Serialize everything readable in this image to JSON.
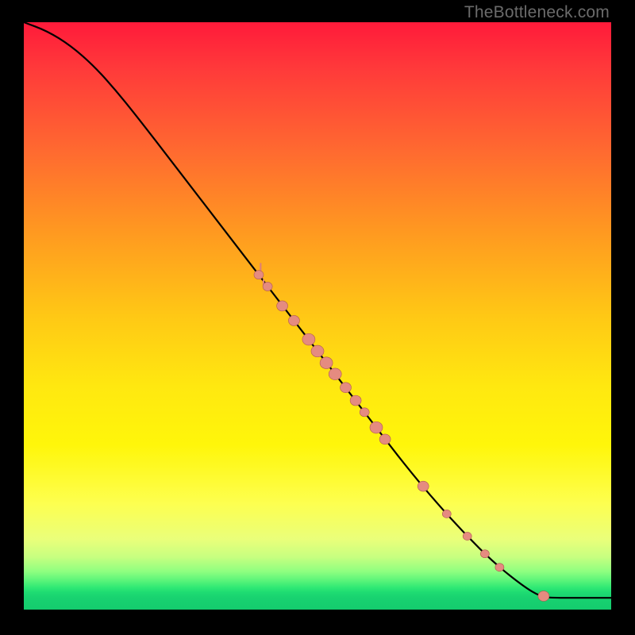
{
  "watermark": "TheBottleneck.com",
  "chart_data": {
    "type": "line",
    "title": "",
    "xlabel": "",
    "ylabel": "",
    "xlim": [
      0,
      100
    ],
    "ylim": [
      0,
      100
    ],
    "curve": [
      {
        "x": 0,
        "y": 100
      },
      {
        "x": 4,
        "y": 98.5
      },
      {
        "x": 8,
        "y": 96
      },
      {
        "x": 12,
        "y": 92.5
      },
      {
        "x": 16,
        "y": 88
      },
      {
        "x": 20,
        "y": 83
      },
      {
        "x": 25,
        "y": 76.5
      },
      {
        "x": 30,
        "y": 70
      },
      {
        "x": 35,
        "y": 63.5
      },
      {
        "x": 40,
        "y": 57
      },
      {
        "x": 45,
        "y": 50.5
      },
      {
        "x": 50,
        "y": 44
      },
      {
        "x": 55,
        "y": 37.5
      },
      {
        "x": 60,
        "y": 31
      },
      {
        "x": 65,
        "y": 24.5
      },
      {
        "x": 70,
        "y": 18.5
      },
      {
        "x": 75,
        "y": 13
      },
      {
        "x": 80,
        "y": 8
      },
      {
        "x": 85,
        "y": 4
      },
      {
        "x": 88,
        "y": 2.2
      },
      {
        "x": 90,
        "y": 2
      },
      {
        "x": 95,
        "y": 2
      },
      {
        "x": 100,
        "y": 2
      }
    ],
    "clusters": [
      {
        "x": 40,
        "y": 57,
        "r": 6
      },
      {
        "x": 41.5,
        "y": 55,
        "r": 6
      },
      {
        "x": 44,
        "y": 51.7,
        "r": 7
      },
      {
        "x": 46,
        "y": 49.2,
        "r": 7
      },
      {
        "x": 48.5,
        "y": 46,
        "r": 8
      },
      {
        "x": 50,
        "y": 44,
        "r": 8
      },
      {
        "x": 51.5,
        "y": 42,
        "r": 8
      },
      {
        "x": 53,
        "y": 40.1,
        "r": 8
      },
      {
        "x": 54.8,
        "y": 37.8,
        "r": 7
      },
      {
        "x": 56.5,
        "y": 35.6,
        "r": 7
      },
      {
        "x": 58,
        "y": 33.6,
        "r": 6
      },
      {
        "x": 60,
        "y": 31,
        "r": 8
      },
      {
        "x": 61.5,
        "y": 29,
        "r": 7
      },
      {
        "x": 68,
        "y": 21,
        "r": 7
      },
      {
        "x": 72,
        "y": 16.3,
        "r": 5.5
      },
      {
        "x": 75.5,
        "y": 12.5,
        "r": 5.5
      },
      {
        "x": 78.5,
        "y": 9.5,
        "r": 5.5
      },
      {
        "x": 81,
        "y": 7.2,
        "r": 5.5
      },
      {
        "x": 88.5,
        "y": 2.3,
        "r": 7
      }
    ],
    "ticks": [
      {
        "x": 40.3,
        "y": 58.2
      },
      {
        "x": 40.8,
        "y": 55.4
      }
    ]
  }
}
